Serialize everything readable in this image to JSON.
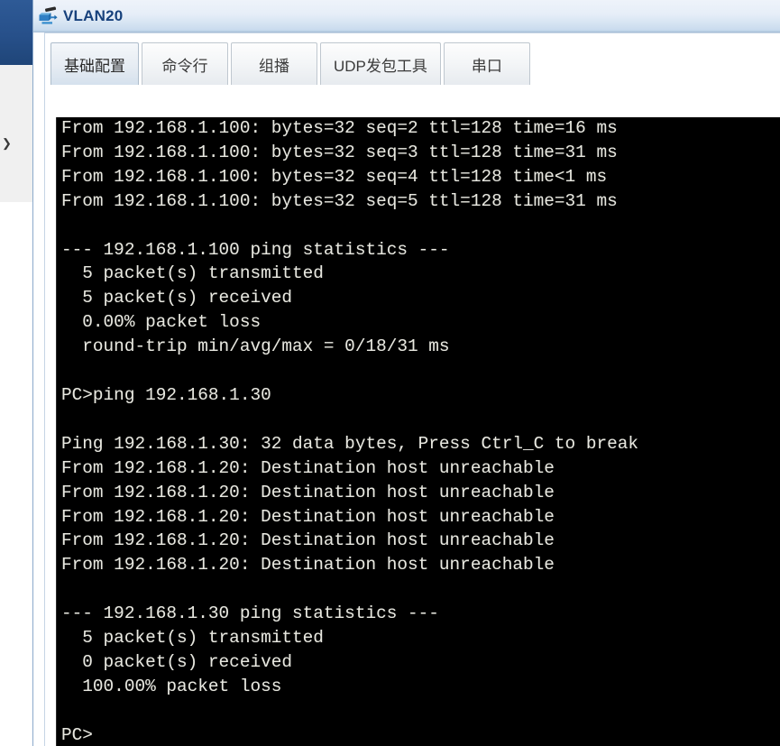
{
  "background_window": {
    "chevron_icon": "❯",
    "titlebar_color": "#27508a",
    "toolbar_color": "#f0f0f0"
  },
  "window": {
    "title": "VLAN20",
    "icon": "pc-device-icon",
    "titlebar_accent": "#17417c"
  },
  "tabs": [
    {
      "label": "基础配置",
      "name": "tab-basic-config",
      "selected": false
    },
    {
      "label": "命令行",
      "name": "tab-command-line",
      "selected": true
    },
    {
      "label": "组播",
      "name": "tab-multicast",
      "selected": false
    },
    {
      "label": "UDP发包工具",
      "name": "tab-udp-packet-tool",
      "selected": false
    },
    {
      "label": "串口",
      "name": "tab-serial-port",
      "selected": false
    }
  ],
  "terminal": {
    "background": "#000000",
    "foreground": "#e8e8e0",
    "lines": [
      "From 192.168.1.100: bytes=32 seq=2 ttl=128 time=16 ms",
      "From 192.168.1.100: bytes=32 seq=3 ttl=128 time=31 ms",
      "From 192.168.1.100: bytes=32 seq=4 ttl=128 time<1 ms",
      "From 192.168.1.100: bytes=32 seq=5 ttl=128 time=31 ms",
      "",
      "--- 192.168.1.100 ping statistics ---",
      "  5 packet(s) transmitted",
      "  5 packet(s) received",
      "  0.00% packet loss",
      "  round-trip min/avg/max = 0/18/31 ms",
      "",
      "PC>ping 192.168.1.30",
      "",
      "Ping 192.168.1.30: 32 data bytes, Press Ctrl_C to break",
      "From 192.168.1.20: Destination host unreachable",
      "From 192.168.1.20: Destination host unreachable",
      "From 192.168.1.20: Destination host unreachable",
      "From 192.168.1.20: Destination host unreachable",
      "From 192.168.1.20: Destination host unreachable",
      "",
      "--- 192.168.1.30 ping statistics ---",
      "  5 packet(s) transmitted",
      "  0 packet(s) received",
      "  100.00% packet loss",
      "",
      "PC>"
    ],
    "text": "From 192.168.1.100: bytes=32 seq=2 ttl=128 time=16 ms\nFrom 192.168.1.100: bytes=32 seq=3 ttl=128 time=31 ms\nFrom 192.168.1.100: bytes=32 seq=4 ttl=128 time<1 ms\nFrom 192.168.1.100: bytes=32 seq=5 ttl=128 time=31 ms\n\n--- 192.168.1.100 ping statistics ---\n  5 packet(s) transmitted\n  5 packet(s) received\n  0.00% packet loss\n  round-trip min/avg/max = 0/18/31 ms\n\nPC>ping 192.168.1.30\n\nPing 192.168.1.30: 32 data bytes, Press Ctrl_C to break\nFrom 192.168.1.20: Destination host unreachable\nFrom 192.168.1.20: Destination host unreachable\nFrom 192.168.1.20: Destination host unreachable\nFrom 192.168.1.20: Destination host unreachable\nFrom 192.168.1.20: Destination host unreachable\n\n--- 192.168.1.30 ping statistics ---\n  5 packet(s) transmitted\n  0 packet(s) received\n  100.00% packet loss\n\nPC>"
  }
}
